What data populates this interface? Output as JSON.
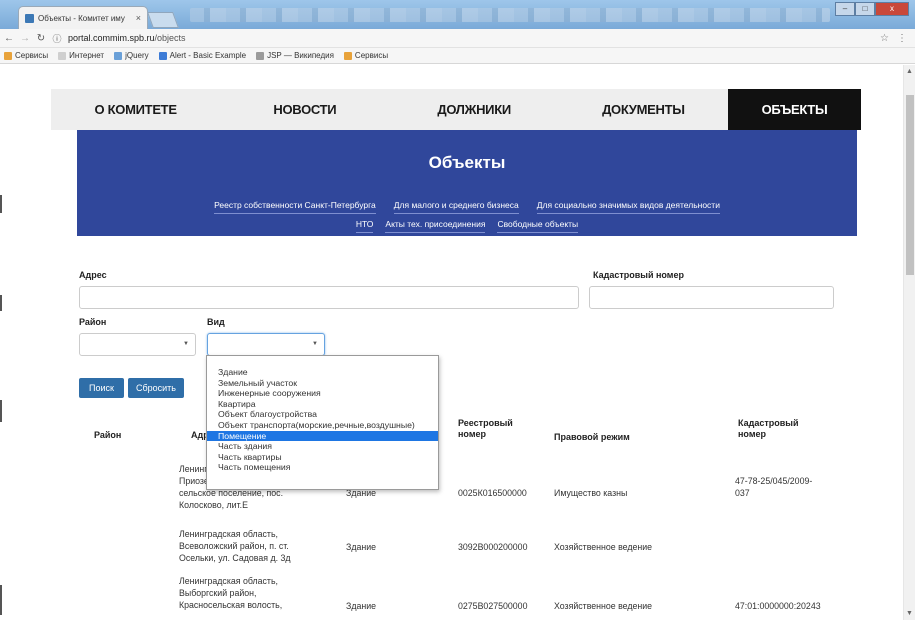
{
  "browser": {
    "tab_title": "Объекты - Комитет иму",
    "tab_close": "×",
    "url_host": "portal.commim.spb.ru",
    "url_path": "/objects",
    "win_min": "–",
    "win_max": "□",
    "win_close": "x",
    "bookmarks": [
      {
        "label": "Сервисы",
        "icon": "apps-icon",
        "color": "#e8a23a"
      },
      {
        "label": "Интернет",
        "icon": "page-icon",
        "color": "#cfcfcf"
      },
      {
        "label": "jQuery",
        "icon": "jquery-icon",
        "color": "#6aa0d8"
      },
      {
        "label": "Alert - Basic Example",
        "icon": "alert-icon",
        "color": "#3c7bd6"
      },
      {
        "label": "JSP — Википедия",
        "icon": "wikipedia-icon",
        "color": "#9b9b9b"
      },
      {
        "label": "Сервисы",
        "icon": "apps-icon",
        "color": "#e8a23a"
      }
    ]
  },
  "nav": {
    "items": [
      "О КОМИТЕТЕ",
      "НОВОСТИ",
      "ДОЛЖНИКИ",
      "ДОКУМЕНТЫ",
      "ОБЪЕКТЫ"
    ]
  },
  "banner": {
    "title": "Объекты",
    "links_row1": [
      "Реестр собственности Санкт-Петербурга",
      "Для малого и среднего бизнеса",
      "Для социально значимых видов деятельности"
    ],
    "links_row2": [
      "НТО",
      "Акты тех. присоединения",
      "Свободные объекты"
    ],
    "color": "#30479b"
  },
  "form": {
    "address_label": "Адрес",
    "cadastral_label": "Кадастровый номер",
    "district_label": "Район",
    "type_label": "Вид",
    "search_button": "Поиск",
    "reset_button": "Сбросить"
  },
  "dropdown": {
    "options": [
      "Здание",
      "Земельный участок",
      "Инженерные сооружения",
      "Квартира",
      "Объект благоустройства",
      "Объект транспорта(морские,речные,воздушные)",
      "Помещение",
      "Часть здания",
      "Часть квартиры",
      "Часть помещения"
    ],
    "selected": "Помещение"
  },
  "table": {
    "headers": {
      "district": "Район",
      "address": "Адрес",
      "registry_line1": "Реестровый",
      "registry_line2": "номер",
      "regime": "Правовой режим",
      "cadastral_line1": "Кадастровый",
      "cadastral_line2": "номер"
    },
    "rows": [
      {
        "address_lines": [
          "Ленинградская область,",
          "Приозерский район,",
          "сельское поселение, пос.",
          "Колосково, лит.Е"
        ],
        "type": "Здание",
        "registry": "0025К016500000",
        "regime": "Имущество казны",
        "cadastral_lines": [
          "47-78-25/045/2009-",
          "037"
        ]
      },
      {
        "address_lines": [
          "Ленинградская область,",
          "Всеволожский район, п. ст.",
          "Осельки, ул. Садовая д. 3д"
        ],
        "type": "Здание",
        "registry": "3092В000200000",
        "regime": "Хозяйственное ведение",
        "cadastral_lines": []
      },
      {
        "address_lines": [
          "Ленинградская область,",
          "Выборгский район,",
          "Красносельская волость,"
        ],
        "type": "Здание",
        "registry": "0275В027500000",
        "regime": "Хозяйственное ведение",
        "cadastral_lines": [
          "47:01:0000000:20243"
        ]
      }
    ]
  }
}
